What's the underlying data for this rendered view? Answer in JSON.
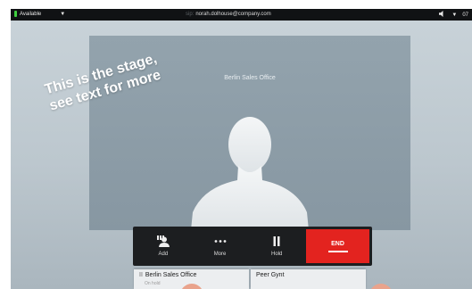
{
  "status_bar": {
    "presence": "Available",
    "user": "norah.dolhouse@company.com",
    "user_prefix": "sip:",
    "time": "07"
  },
  "stage": {
    "title": "Berlin Sales Office",
    "note": "This is the stage, see text for more"
  },
  "toolbar": {
    "add_label": "Add",
    "more_label": "More",
    "hold_label": "Hold",
    "end_label": "END"
  },
  "calls": [
    {
      "name": "Berlin Sales Office",
      "state": "On hold"
    },
    {
      "name": "Peer Gynt"
    }
  ],
  "colors": {
    "end_button": "#e3231f",
    "presence_available": "#3fcf3f",
    "status_bar": "#101214"
  }
}
